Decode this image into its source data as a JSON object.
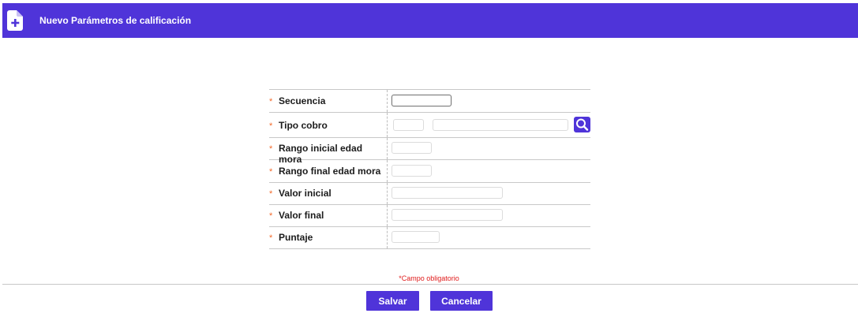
{
  "header": {
    "title": "Nuevo Parámetros de calificación",
    "icon": "file-plus-icon",
    "background": "#4f34d9"
  },
  "form": {
    "required_mark": "*",
    "fields": [
      {
        "key": "secuencia",
        "label": "Secuencia",
        "value": ""
      },
      {
        "key": "tipo_cobro",
        "label": "Tipo cobro",
        "code_value": "",
        "description_value": ""
      },
      {
        "key": "rango_inicial",
        "label": "Rango inicial edad mora",
        "value": ""
      },
      {
        "key": "rango_final",
        "label": "Rango final edad mora",
        "value": ""
      },
      {
        "key": "valor_inicial",
        "label": "Valor inicial",
        "value": ""
      },
      {
        "key": "valor_final",
        "label": "Valor final",
        "value": ""
      },
      {
        "key": "puntaje",
        "label": "Puntaje",
        "value": ""
      }
    ],
    "search_icon": "search-icon"
  },
  "footer": {
    "required_note": "*Campo obligatorio",
    "save_label": "Salvar",
    "cancel_label": "Cancelar"
  },
  "colors": {
    "accent": "#4f34d9",
    "required": "#f36b2c",
    "note": "#e01b1b"
  }
}
